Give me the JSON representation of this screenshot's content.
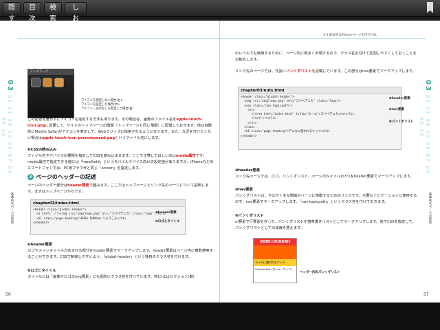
{
  "toolbar": {
    "hide": "隠す",
    "toc": "目次",
    "search": "検索",
    "bookmark": "しおり"
  },
  "left": {
    "runhead": "",
    "chapter_num": "03",
    "side_label": "基本的なページの作成",
    "phone": {
      "header": "ブックマーク"
    },
    "phone_caption": [
      "アイコンを指定しない場合(左)、",
      "アイコンを設定した場合(中)、",
      "アイコン・光沢なしを指定した場合(右)"
    ],
    "para1": "この記述を書かずにアイコンを指定する方法もあります。その場合は、画像のファイル名を",
    "para1_red": "apple-touch-icon.png",
    "para1b": "に変更して、サイトのトップページの階層（トップページと同じ階層）に配置しておきます。他は自動的にMobile Safariがアイコンを表示して、Webクリップに採用されるようになります。また、光沢を付けたくない場合は",
    "para1_red2": "apple-touch-icon-precomposed.png",
    "para1c": "というファイル名にします。",
    "css_head": "❸CSSの読み込み",
    "css_body": "ファイル名やデバイスの種類を指定してCSSを読み込ませます。ここで注意してほしいのは",
    "css_red": "media属性",
    "css_body2": "です。media属性で指定できる値には「handheld」というモバイルデバイス向けの設定値がありますが、iPhoneなどのスマートフォンでは、PC用ブラウザと同じ「screen」を指定します。",
    "section_title": "ページのヘッダーの記述",
    "section_body": "ページのヘッダー部分は",
    "section_red": "header要素",
    "section_body2": "で囲みます。ここではトップページとリンク先のページについて説明します。まずはトップページからです。",
    "code_title": "chapter03/index.html",
    "code_lines": [
      "<header class=\"global-header\">",
      "  <a href=\"./\"><img src=\"img/logo.png\" alt=\"コベペデュカ\" class=\"logo\" /></a>",
      "  <h1 class=\"page-heading\">KOBE DUKKAH へようこそ</h1>",
      "</header>"
    ],
    "callout1": "❶header要素",
    "callout2": "❷ロゴとタイトル",
    "h_header": "❶header要素",
    "header_body": "ロゴやメインタイトルが含まれる部分をheader要素でマークアップします。header要素はページ内に複数使用することができます。CSSで制御しやすいよう、「global-header」という独自のクラス名を付けます。",
    "h_logo": "❷ロゴとタイトル",
    "logo_body": "タイトルには「画像やロゴのimg要素」にも個別にクラス名を付けています。特にh1はセクション(節)",
    "page_number": "56"
  },
  "right": {
    "runhead": "3-3  基本的なiPhoneページを作りFML",
    "chapter_num": "03",
    "side_label": "基本的なページの作成",
    "para1": "のレベルでも使用するために、ページ内に数多く出現するので、クラス名を付けて区別しやすくしておくことをお勧めします。",
    "para2a": "リンク先のページでは、冗談に",
    "para2_red": "パンくずリスト",
    "para2b": "を記載しています。この部分はnav要素でマークアップします。",
    "code_title": "chapter03/nuts.html",
    "code_lines": [
      "<header class=\"global-header\">",
      "  <img src=\"img/logo.png\" alt=\"コベペデュカ\" class=\"logo\">",
      "  <nav class=\"nav-topicpath\">",
      "    <ul>",
      "      <li><a href=\"index.html\" title=\"ホーム\">コベペデュカ</a></li>",
      "      <li>ナッツ</li>",
      "    </ul>",
      "  </nav>",
      "  <h1 class=\"page-heading\">デュカに使われるナッツ</h1>",
      "</header>"
    ],
    "callout1": "❶header要素",
    "callout2": "❷nav要素",
    "callout3": "❸パンくずリスト",
    "h1": "❶header要素",
    "b1": "リンク先ページでは、ロゴ、パンくずリスト、ページのタイトルの3つをheader要素でマークアップします。",
    "h2": "❷nav要素",
    "b2": "パンくずリストは、すばやく主な場面のページに移動するためのリンクです。主要なナビゲーションに使用するので、nav要素でマークアップします。「nav-topicpath」というクラス名を付けておきます。",
    "h3": "❸パンくずリスト",
    "b3": "ul要素で行要素を作って、パンくずリストを箇条書きリストとしてマークアップします。後でCSSを指定して、パンくずリストとしての体裁を整えます。",
    "sample": {
      "logo": "KOBE×DUKKAH",
      "sub": "デュカに使われるナッツ",
      "foot": "Cashew Nut (カシューナッツ)"
    },
    "sample_caption": "ヘッダー内のパンくずリスト",
    "page_number": "57"
  }
}
